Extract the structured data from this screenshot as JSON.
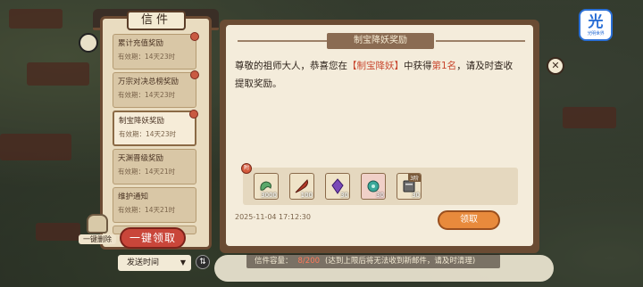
{
  "badge": {
    "glyph": "光",
    "subtext": "光明世界"
  },
  "mailbox": {
    "title": "信件",
    "items": [
      {
        "title": "累计充值奖励",
        "validity": "有效期：14天23时",
        "selected": false
      },
      {
        "title": "万宗对决总榜奖励",
        "validity": "有效期：14天23时",
        "selected": false
      },
      {
        "title": "制宝降妖奖励",
        "validity": "有效期：14天23时",
        "selected": true
      },
      {
        "title": "天渊晋级奖励",
        "validity": "有效期：14天21时",
        "selected": false
      },
      {
        "title": "维护通知",
        "validity": "有效期：14天21时",
        "selected": false
      }
    ],
    "one_delete_label": "一键删除",
    "collect_all_label": "一键领取",
    "sort_label": "发送时间",
    "sort_toggle_icon": "⇅"
  },
  "message": {
    "header": "制宝降妖奖励",
    "greeting": "尊敬的祖师大人，恭喜您在",
    "event": "【制宝降妖】",
    "mid": "中获得",
    "rank": "第1名",
    "tail": "，请及时查收提取奖励。",
    "reward_tag": "附",
    "rewards": [
      {
        "icon": "green-jade-icon",
        "qty": "3000",
        "color": "#5aa86a"
      },
      {
        "icon": "red-feather-icon",
        "qty": "100",
        "color": "#b33a2a"
      },
      {
        "icon": "purple-crystal-icon",
        "qty": "30",
        "color": "#7a4ab8"
      },
      {
        "icon": "jade-relic-icon",
        "qty": "30",
        "color": "#3aa89a"
      },
      {
        "icon": "scroll-book-icon",
        "qty": "30",
        "grade": "3阶",
        "color": "#6a6a6a"
      }
    ],
    "date": "2025-11-04 17:12:30",
    "claim_label": "领取"
  },
  "capacity": {
    "label": "信件容量：",
    "count": "8/200",
    "note": "(达到上限后将无法收到新邮件，请及时清理)"
  },
  "close_icon": "✕"
}
